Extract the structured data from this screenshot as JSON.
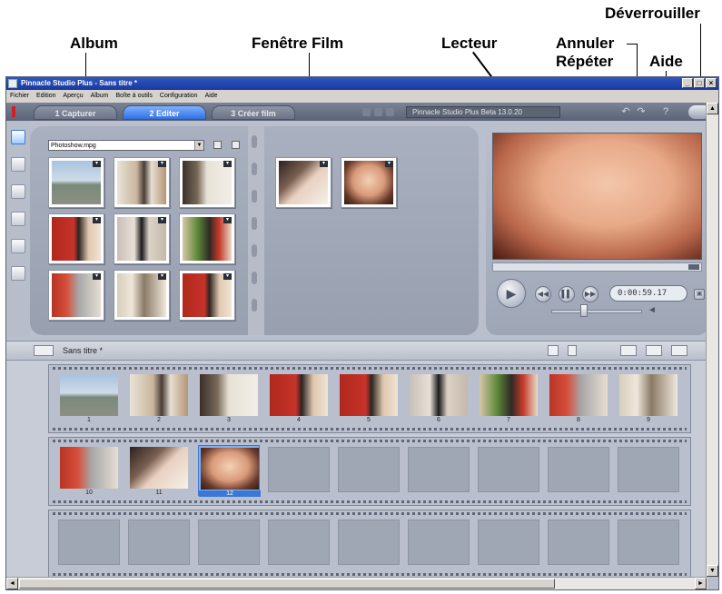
{
  "callouts": {
    "album": "Album",
    "film_window": "Fenêtre Film",
    "player": "Lecteur",
    "undo": "Annuler",
    "redo": "Répéter",
    "help": "Aide",
    "unlock": "Déverrouiller"
  },
  "window": {
    "title": "Pinnacle Studio Plus - Sans titre *",
    "controls": [
      "_",
      "□",
      "×"
    ]
  },
  "menu": [
    "Fichier",
    "Edition",
    "Aperçu",
    "Album",
    "Boîte à outils",
    "Configuration",
    "Aide"
  ],
  "tabs": [
    "1 Capturer",
    "2 Editer",
    "3 Créer film"
  ],
  "active_tab": "2 Editer",
  "project_name": "Pinnacle Studio Plus Beta 13.0.20",
  "album": {
    "source_file": "Photoshow.mpg"
  },
  "player": {
    "timecode": "0:00:59.17"
  },
  "storyboard": {
    "title": "Sans titre *",
    "clips": [
      "1",
      "2",
      "3",
      "4",
      "5",
      "6",
      "7",
      "8",
      "9",
      "10",
      "11",
      "12"
    ],
    "selected_clip": "12"
  },
  "icons": {
    "undo": "undo-icon",
    "redo": "redo-icon",
    "help": "help-icon",
    "unlock": "unlock-icon",
    "play": "play-icon",
    "volume": "speaker-icon"
  },
  "colors": {
    "active_tab": "#2f70e4",
    "selection": "#3b78d6",
    "titlebar": "#1a3a9a"
  }
}
